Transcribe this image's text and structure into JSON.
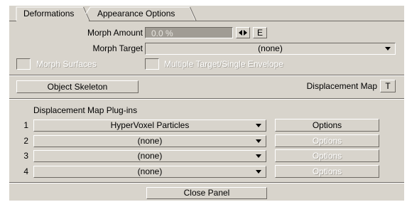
{
  "tabs": [
    {
      "label": "Deformations",
      "active": true
    },
    {
      "label": "Appearance Options",
      "active": false
    }
  ],
  "morph": {
    "amount_label": "Morph Amount",
    "amount_value": "0.0 %",
    "envelope_icon": "double-arrow-icon",
    "e_button": "E",
    "target_label": "Morph Target",
    "target_value": "(none)",
    "surfaces_label": "Morph Surfaces",
    "multiple_label": "Multiple Target/Single Envelope"
  },
  "skeleton": {
    "button_label": "Object Skeleton",
    "displacement_label": "Displacement Map",
    "t_button": "T"
  },
  "plugins": {
    "heading": "Displacement Map Plug-ins",
    "rows": [
      {
        "num": "1",
        "value": "HyperVoxel Particles",
        "options": "Options",
        "options_enabled": true
      },
      {
        "num": "2",
        "value": "(none)",
        "options": "Options",
        "options_enabled": false
      },
      {
        "num": "3",
        "value": "(none)",
        "options": "Options",
        "options_enabled": false
      },
      {
        "num": "4",
        "value": "(none)",
        "options": "Options",
        "options_enabled": false
      }
    ]
  },
  "footer": {
    "close_label": "Close Panel"
  },
  "colors": {
    "panel_bg": "#d8d4cc",
    "field_bg": "#a09c94",
    "shadow": "#6e6a64"
  }
}
